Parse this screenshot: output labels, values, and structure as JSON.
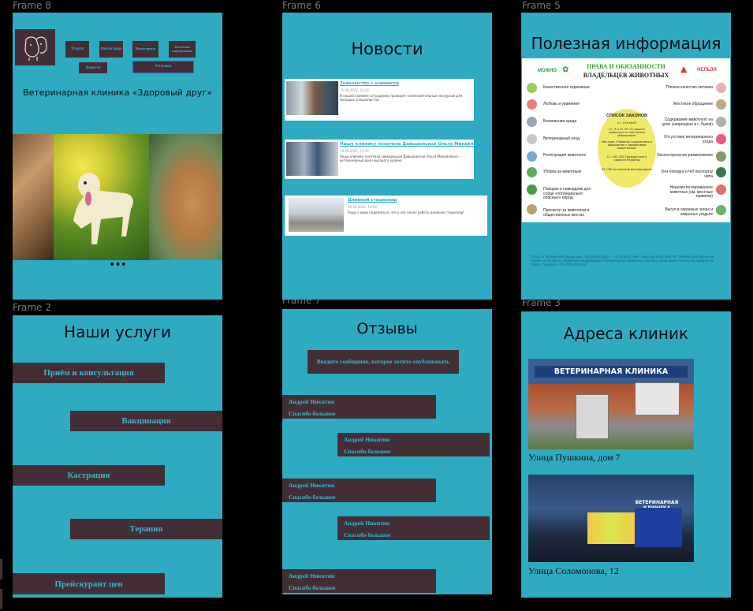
{
  "canvas": {
    "frames": {
      "frame8": "Frame 8",
      "frame6": "Frame 6",
      "frame5": "Frame 5",
      "frame2": "Frame 2",
      "frame7": "Frame 7",
      "frame3": "Frame 3"
    }
  },
  "home": {
    "nav": {
      "services": "Услуги",
      "photos": "Фотки вида",
      "specialists": "Наши врачи",
      "useful": "Полезная информация",
      "news": "Новости",
      "reviews": "Отзывы"
    },
    "clinic_name": "Ветеринарная клиника «Здоровый друг»",
    "carousel_dots": "•••"
  },
  "news": {
    "title": "Новости",
    "items": [
      {
        "title": "Знакомство с клиникой",
        "date": "15.09.2022, 10:26",
        "text": "В нашей клинике сотрудники проводят ознакомительные экскурсии для молодых специалистов"
      },
      {
        "title": "Нашу клинику посетила Давыдовская Ольга Михайловна",
        "date": "16.09.2022, 11:35",
        "text": "Нашу клинику посетила заведующая Давыдовская Ольга Михайловна – ветеринарный врач высокого уровня"
      },
      {
        "title": "Дневной стационар",
        "date": "06.09.2022, 19:04",
        "text": "Рады с вами поделиться, что у нас начал работу дневной стационар!"
      }
    ]
  },
  "info": {
    "title": "Полезная информация",
    "allowed": "МОЖНО",
    "forbidden": "НЕЛЬЗЯ",
    "heading_line1": "ПРАВА И ОБЯЗАННОСТИ",
    "heading_line2": "ВЛАДЕЛЬЦЕВ ЖИВОТНЫХ",
    "laws_title": "СПИСОК ЗАКОНОВ",
    "laws": [
      "Ст. 154 КоАП",
      "Ст. 9 и 22 ЗП «О защите животных от жестокого обращения»",
      "Местные «Правила содержания и обращения с домашними животными»",
      "Ст. 245-262 Гражданского кодекса Украины",
      "ЗУ «Об экстренной ветеринарии»"
    ],
    "left_items": [
      "Качественное кормление",
      "Любовь и уважение",
      "Безопасная среда",
      "Ветеринарный уход",
      "Регистрация животного",
      "Уборка за животным",
      "Поводок и намордник для собак «потенциально опасных» пород",
      "Присмотр за животным в общественных местах"
    ],
    "right_items": [
      "Плохое качество питания",
      "Жестокое обращение",
      "Содержание животного на цепи (запрещено в г. Львов)",
      "Отсутствие ветеринарного ухода",
      "Бесконтрольное размножение",
      "Без поводка и ЧИ паспорта/чипа",
      "Нерезистентированное животных (см. местные правила)",
      "Выгул в охранных зонах и закрытых угодьях"
    ],
    "footer_text": "Отказ от проведения вакцинации «Здоровый друг» — в соответствии с законодательством РБ. Звоните для записи на прием по телефону. Подробная информация о ветеринарных правилах и законах, касающихся хозяев, вы найдете на сайте. Телефон: +375 (29) 123 45 67"
  },
  "services": {
    "title": "Наши услуги",
    "items": [
      "Приём и консультация",
      "Вакцинация",
      "Кастрация",
      "Терапия",
      "Прейскурант цен"
    ]
  },
  "reviews": {
    "title": "Отзывы",
    "input_placeholder": "Введите сообщение, которое хотите опубликовать",
    "items": [
      {
        "author": "Андрей Никитин",
        "text": "Спасибо большое"
      },
      {
        "author": "Андрей Никитин",
        "text": "Спасибо большое"
      },
      {
        "author": "Андрей Никитин",
        "text": "Спасибо большое"
      },
      {
        "author": "Андрей Никитин",
        "text": "Спасибо большое"
      },
      {
        "author": "Андрей Никитин",
        "text": "Спасибо большое"
      }
    ]
  },
  "addresses": {
    "title": "Адреса клиник",
    "sign1": "ВЕТЕРИНАРНАЯ КЛИНИКА",
    "sign2": "ВЕТЕРИНАРНАЯ КЛИНИКА",
    "items": [
      "Улица Пушкина, дом 7",
      "Улица Соломонова, 12"
    ]
  },
  "colors": {
    "frame_bg": "#2eabc0",
    "dark_block": "#432e36",
    "block_text": "#36b7c7",
    "canvas_bg": "#000000",
    "news_link": "#27a9e0"
  }
}
